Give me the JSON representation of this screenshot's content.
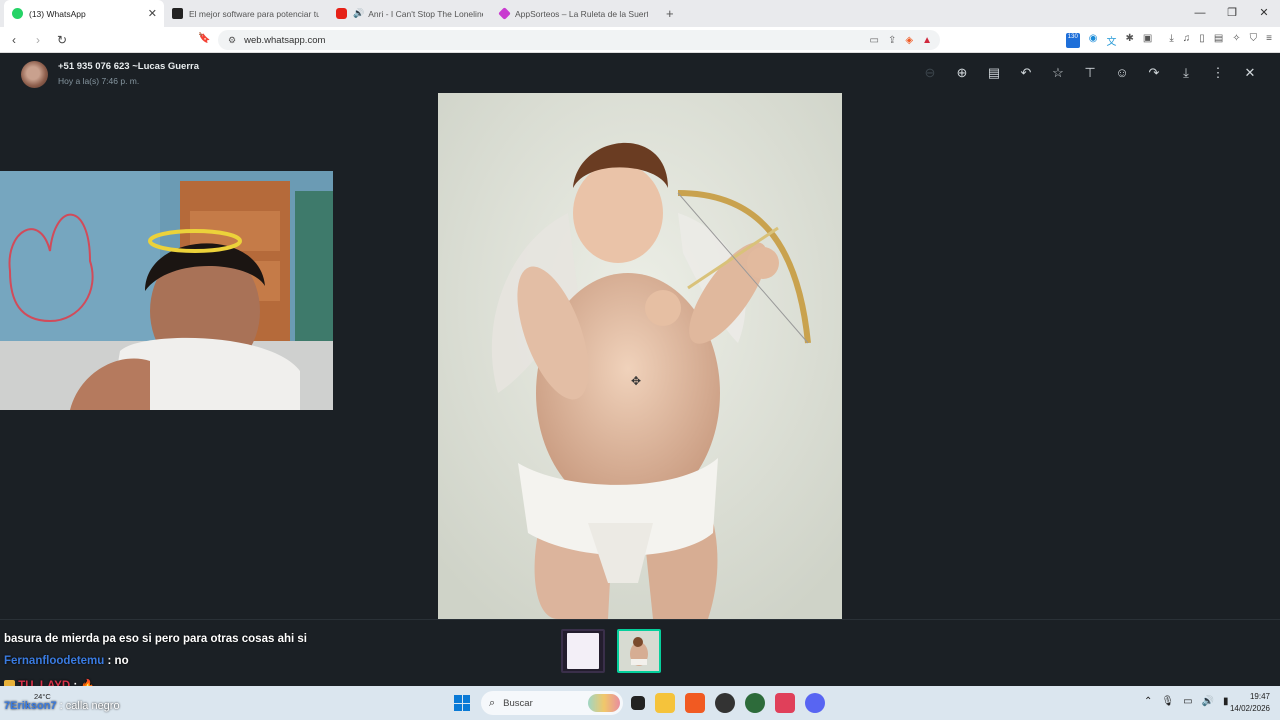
{
  "browser": {
    "tabs": [
      {
        "label": "(13) WhatsApp",
        "favicon_color": "#25d366",
        "active": true
      },
      {
        "label": "El mejor software para potenciar tu s",
        "favicon_color": "#222222",
        "active": false
      },
      {
        "label": "Anri - I Can't Stop The Loneliness",
        "favicon_color": "#e62117",
        "active": false
      },
      {
        "label": "AppSorteos – La Ruleta de la Suerte",
        "favicon_color": "#c93bd0",
        "active": false
      }
    ],
    "new_tab": "+",
    "url": "web.whatsapp.com",
    "extension_badge": "130"
  },
  "viewer": {
    "sender_name": "+51 935 076 623 ~Lucas Guerra",
    "sender_time": "Hoy a la(s) 7:46 p. m."
  },
  "chat": {
    "line1": "basura de mierda pa eso si pero para otras cosas ahi si",
    "line2_user": "Fernanfloodetemu",
    "line2_msg": ": no",
    "line3_user": "TU_LAYD",
    "line3_msg": ":",
    "line4_user": "7Erikson7",
    "line4_msg": ": calla negro"
  },
  "taskbar": {
    "search_placeholder": "Buscar",
    "weather_temp": "24°C",
    "time": "19:47",
    "date": "14/02/2026"
  },
  "colors": {
    "whatsapp_accent": "#06cf9c",
    "viewer_bg": "#1b2025"
  }
}
